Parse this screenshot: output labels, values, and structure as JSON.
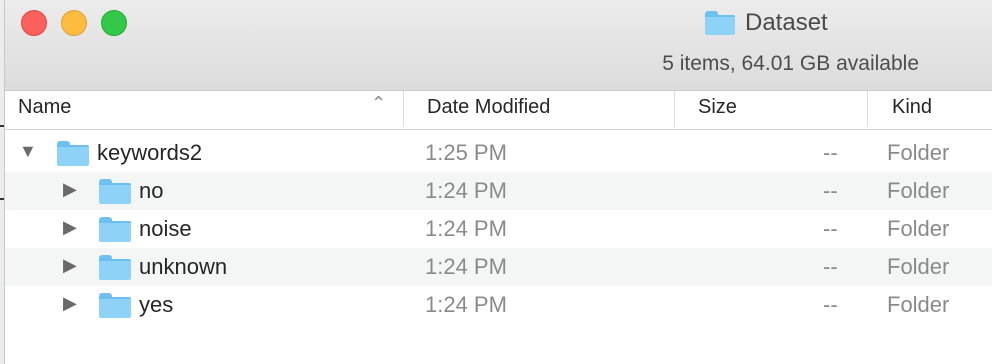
{
  "window": {
    "title": "Dataset",
    "status": "5 items, 64.01 GB available"
  },
  "columns": {
    "name": "Name",
    "date": "Date Modified",
    "size": "Size",
    "kind": "Kind"
  },
  "sort": {
    "column": "Name",
    "direction": "ascending"
  },
  "icons": {
    "folder": "folder-icon",
    "expanded": "disclosure-triangle-down-icon",
    "collapsed": "disclosure-triangle-right-icon"
  },
  "colors": {
    "close": "#fc605c",
    "minimize": "#fdbc40",
    "zoom": "#34c84a",
    "folder": "#8fd2f8"
  },
  "rows": [
    {
      "name": "keywords2",
      "date": "1:25 PM",
      "size": "--",
      "kind": "Folder",
      "expanded": true,
      "level": 0
    },
    {
      "name": "no",
      "date": "1:24 PM",
      "size": "--",
      "kind": "Folder",
      "expanded": false,
      "level": 1
    },
    {
      "name": "noise",
      "date": "1:24 PM",
      "size": "--",
      "kind": "Folder",
      "expanded": false,
      "level": 1
    },
    {
      "name": "unknown",
      "date": "1:24 PM",
      "size": "--",
      "kind": "Folder",
      "expanded": false,
      "level": 1
    },
    {
      "name": "yes",
      "date": "1:24 PM",
      "size": "--",
      "kind": "Folder",
      "expanded": false,
      "level": 1
    }
  ]
}
